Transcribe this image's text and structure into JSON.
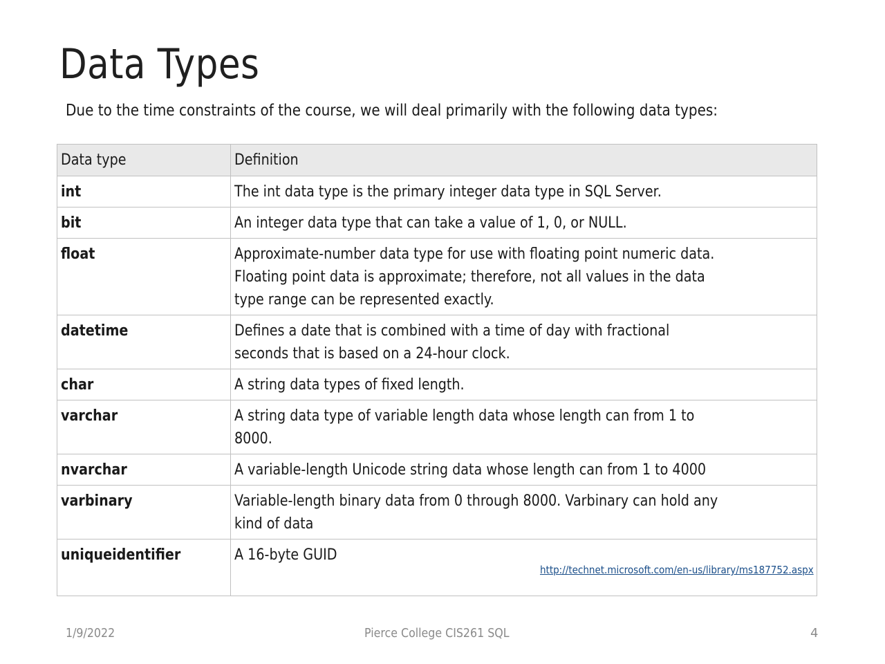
{
  "slide": {
    "title": "Data Types",
    "subtitle": "Due to the time constraints of the course, we will deal primarily with the following data types:"
  },
  "table": {
    "headers": [
      "Data type",
      "Definition"
    ],
    "rows": [
      {
        "type": "int",
        "definition": [
          "The int data type is the primary integer data type in SQL Server."
        ]
      },
      {
        "type": "bit",
        "definition": [
          "An integer data type that can take a value of 1, 0, or NULL."
        ]
      },
      {
        "type": "float",
        "definition": [
          "Approximate-number data type for use with floating point numeric data.",
          "Floating point data is approximate; therefore, not all values in the data",
          "type range can be represented exactly."
        ]
      },
      {
        "type": "datetime",
        "definition": [
          "Defines a date that is combined with a time of day with fractional",
          "seconds that is based on a 24-hour clock."
        ]
      },
      {
        "type": "char",
        "definition": [
          "A string data types of fixed length."
        ]
      },
      {
        "type": "varchar",
        "definition": [
          "A string data type of variable length data whose length can from 1 to",
          "8000."
        ]
      },
      {
        "type": "nvarchar",
        "definition": [
          "A variable-length Unicode string data whose length can from 1 to 4000"
        ]
      },
      {
        "type": "varbinary",
        "definition": [
          "Variable-length binary data from 0 through 8000. Varbinary can hold any",
          "kind of data"
        ]
      },
      {
        "type": "uniqueidentifier",
        "definition": [
          "A 16-byte GUID"
        ]
      }
    ],
    "source_link": "http://technet.microsoft.com/en-us/library/ms187752.aspx"
  },
  "footer": {
    "date": "1/9/2022",
    "center": "Pierce College CIS261 SQL",
    "page": "4"
  }
}
